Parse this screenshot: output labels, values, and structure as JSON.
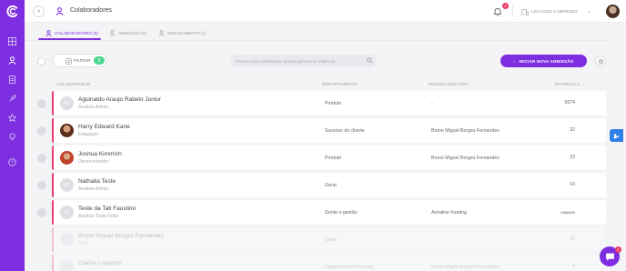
{
  "header": {
    "collapse_label": "»",
    "page_title": "Colaboradores",
    "notifications_count": "3",
    "company_name": "LIGA DOS CAMPEÕES"
  },
  "tabs": [
    {
      "label": "COLABORADORES (5)",
      "active": true
    },
    {
      "label": "ADMISSÃO (6)",
      "active": false
    },
    {
      "label": "DESLIGAMENTO (1)",
      "active": false
    }
  ],
  "toolbar": {
    "filter_label": "FILTRAR",
    "filter_count": "5",
    "search_placeholder": "Procure pelo colaborador, pessoa gestora ou matrícula",
    "new_admission_label": "INICIAR NOVA ADMISSÃO"
  },
  "table": {
    "headers": {
      "collaborator": "COLABORADOR",
      "department": "DEPARTAMENTO",
      "manager": "PESSOA GESTORA",
      "registration": "MATRÍCULA"
    },
    "rows": [
      {
        "initials": "AJ",
        "name": "Aguinaldo Araujo Rabelo Junior",
        "role": "Analista Admin.",
        "department": "Produto",
        "manager": "-",
        "registration": "5674"
      },
      {
        "initials": "",
        "name": "Harry Edward Kane",
        "role": "Estagiario",
        "department": "Sucesso do cliente",
        "manager": "Bruno Miguel Borges Fernandes",
        "registration": "32"
      },
      {
        "initials": "",
        "name": "Joshua Kimmich",
        "role": "Desenvolvedor",
        "department": "Produto",
        "manager": "Bruno Miguel Borges Fernandes",
        "registration": "23"
      },
      {
        "initials": "NT",
        "name": "Nathalia Teste",
        "role": "Analista Admin.",
        "department": "Geral",
        "manager": "-",
        "registration": "16"
      },
      {
        "initials": "TF",
        "name": "Teste da Tati Faustino",
        "role": "Analista Teste Debs",
        "department": "Gente e gestão",
        "manager": "Annalise Keating",
        "registration": "8888888"
      },
      {
        "initials": "",
        "name": "Bruno Miguel Borges Fernandes",
        "role": "CEO",
        "department": "Geral",
        "manager": "",
        "registration": "35"
      },
      {
        "initials": "",
        "name": "Clarice Lispector",
        "role": "",
        "department": "Departamento Pessoal",
        "manager": "Bruno Miguel Borges Fernandes",
        "registration": "5"
      }
    ]
  },
  "chat_badge": "1",
  "colors": {
    "accent": "#7d2ee0",
    "row_border": "#e8406a",
    "badge": "#e8385f",
    "filter_count": "#4dd68c"
  }
}
